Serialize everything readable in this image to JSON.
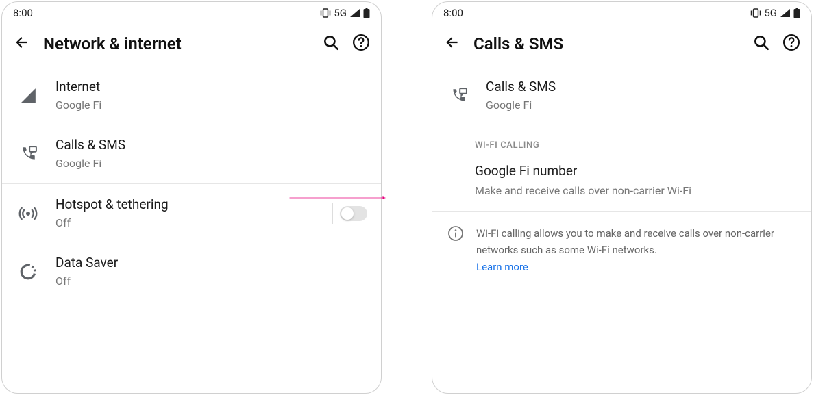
{
  "status": {
    "time": "8:00",
    "network": "5G"
  },
  "left": {
    "title": "Network & internet",
    "items": [
      {
        "label": "Internet",
        "sub": "Google Fi"
      },
      {
        "label": "Calls & SMS",
        "sub": "Google Fi"
      },
      {
        "label": "Hotspot & tethering",
        "sub": "Off"
      },
      {
        "label": "Data Saver",
        "sub": "Off"
      }
    ]
  },
  "right": {
    "title": "Calls & SMS",
    "header": {
      "label": "Calls & SMS",
      "sub": "Google Fi"
    },
    "section_header": "WI-FI CALLING",
    "section_item": {
      "title": "Google Fi number",
      "sub": "Make and receive calls over non-carrier Wi-Fi"
    },
    "info": {
      "text": "Wi-Fi calling allows you to make and receive calls over non-carrier networks such as some Wi-Fi networks.",
      "learn_more": "Learn more"
    }
  }
}
